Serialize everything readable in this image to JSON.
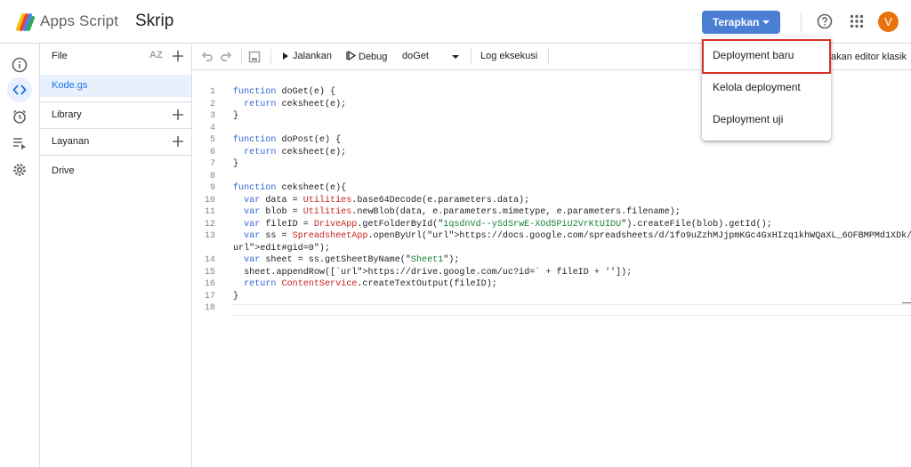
{
  "header": {
    "app_name": "Apps Script",
    "project_name": "Skrip",
    "deploy_label": "Terapkan",
    "avatar_initial": "V"
  },
  "files_panel": {
    "title": "File",
    "sort_label": "AZ",
    "files": [
      "Kode.gs"
    ],
    "library_label": "Library",
    "services_label": "Layanan",
    "drive_label": "Drive"
  },
  "toolbar": {
    "run_label": "Jalankan",
    "debug_label": "Debug",
    "function_select": "doGet",
    "log_label": "Log eksekusi"
  },
  "legacy_link": "akan editor klasik",
  "deploy_menu": {
    "items": [
      "Deployment baru",
      "Kelola deployment",
      "Deployment uji"
    ]
  },
  "editor": {
    "line_numbers": [
      "1",
      "2",
      "3",
      "4",
      "5",
      "6",
      "7",
      "8",
      "9",
      "10",
      "11",
      "12",
      "13",
      "14",
      "15",
      "16",
      "17",
      "18"
    ],
    "lines": [
      "function doGet(e) {",
      "  return ceksheet(e);",
      "}",
      "",
      "function doPost(e) {",
      "  return ceksheet(e);",
      "}",
      "",
      "function ceksheet(e){",
      "  var data = Utilities.base64Decode(e.parameters.data);",
      "  var blob = Utilities.newBlob(data, e.parameters.mimetype, e.parameters.filename);",
      "  var fileID = DriveApp.getFolderById(\"1qsdnVd--ySdSrwE-XOd5PiU2VrKtUIDU\").createFile(blob).getId();",
      "  var ss = SpreadsheetApp.openByUrl(\"https://docs.google.com/spreadsheets/d/1fo9uZzhMJjpmKGc4GxHIzq1khWQaXL_6OFBMPMd1XDk/",
      "edit#gid=0\");",
      "  var sheet = ss.getSheetByName(\"Sheet1\");",
      "  sheet.appendRow([`https://drive.google.com/uc?id=` + fileID + '']);",
      "  return ContentService.createTextOutput(fileID);",
      "}",
      ""
    ]
  }
}
